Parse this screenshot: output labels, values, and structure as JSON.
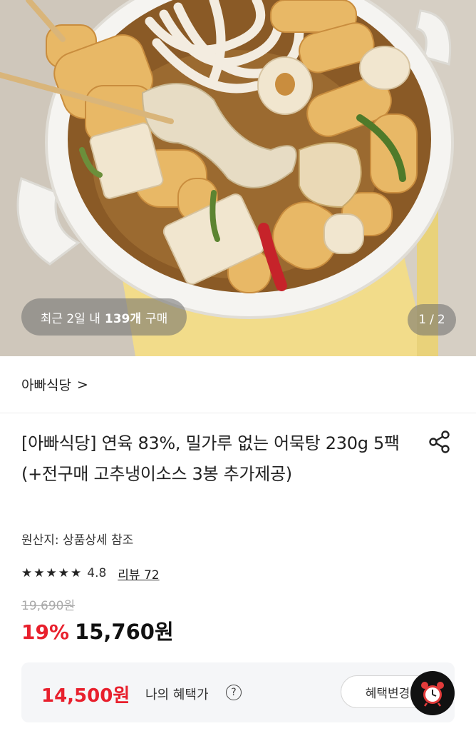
{
  "hero": {
    "purchase_badge": {
      "prefix": "최근 2일 내",
      "count": "139개",
      "suffix": "구매"
    },
    "page_indicator": {
      "current": "1",
      "separator": "/",
      "total": "2"
    }
  },
  "store": {
    "name": "아빠식당",
    "chevron": ">"
  },
  "product": {
    "title": "[아빠식당] 연육 83%, 밀가루 없는 어묵탕 230g 5팩 (+전구매 고추냉이소스 3봉 추가제공)",
    "origin": "원산지: 상품상세 참조",
    "rating": {
      "stars": 5,
      "value": "4.8",
      "review_label": "리뷰 72"
    },
    "price": {
      "original": "19,690원",
      "discount": "19%",
      "sale": "15,760원"
    }
  },
  "benefit": {
    "price": "14,500원",
    "label": "나의 혜택가",
    "help": "?",
    "change_button": "혜택변경"
  },
  "icons": {
    "share": "share-icon",
    "help": "question-icon",
    "alarm": "alarm-clock-icon",
    "star": "star-icon"
  },
  "colors": {
    "accent_red": "#e8202d",
    "text": "#222222",
    "benefit_bg": "#f5f6f8"
  }
}
